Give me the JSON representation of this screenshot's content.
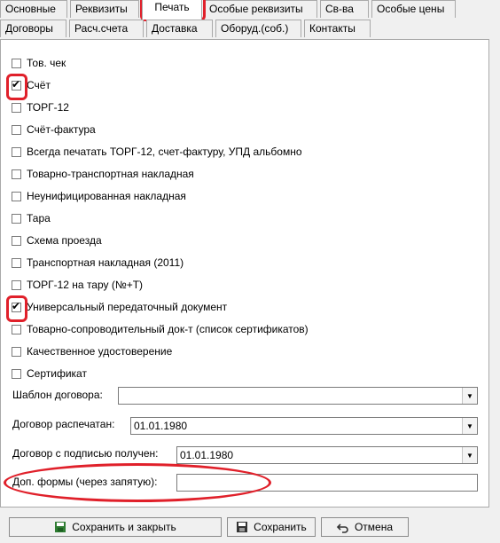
{
  "tabs_row1": [
    "Основные",
    "Реквизиты",
    "Печать",
    "Особые реквизиты",
    "Св-ва",
    "Особые цены"
  ],
  "tabs_row2": [
    "Договоры",
    "Расч.счета",
    "Доставка",
    "Оборуд.(соб.)",
    "Контакты"
  ],
  "checkboxes": [
    {
      "label": "Тов. чек",
      "checked": false
    },
    {
      "label": "Счёт",
      "checked": true
    },
    {
      "label": "ТОРГ-12",
      "checked": false
    },
    {
      "label": "Счёт-фактура",
      "checked": false
    },
    {
      "label": "Всегда печатать ТОРГ-12, счет-фактуру, УПД альбомно",
      "checked": false
    },
    {
      "label": "Товарно-транспортная накладная",
      "checked": false
    },
    {
      "label": "Неунифицированная накладная",
      "checked": false
    },
    {
      "label": "Тара",
      "checked": false
    },
    {
      "label": "Схема проезда",
      "checked": false
    },
    {
      "label": "Транспортная накладная (2011)",
      "checked": false
    },
    {
      "label": "ТОРГ-12 на тару (№+Т)",
      "checked": false
    },
    {
      "label": "Универсальный передаточный документ",
      "checked": true
    },
    {
      "label": "Товарно-сопроводительный док-т (список сертификатов)",
      "checked": false
    },
    {
      "label": "Качественное удостоверение",
      "checked": false
    },
    {
      "label": "Сертификат",
      "checked": false
    }
  ],
  "fields": {
    "template_label": "Шаблон договора:",
    "template_value": "",
    "printed_label": "Договор распечатан:",
    "printed_value": "01.01.1980",
    "signed_label": "Договор с подписью получен:",
    "signed_value": "01.01.1980",
    "extra_label": "Доп. формы (через запятую):",
    "extra_value": ""
  },
  "buttons": {
    "save_close": "Сохранить и закрыть",
    "save": "Сохранить",
    "cancel": "Отмена"
  },
  "icons": {
    "save_close": "save-close-icon",
    "save": "floppy-disk-icon",
    "cancel": "undo-icon"
  }
}
